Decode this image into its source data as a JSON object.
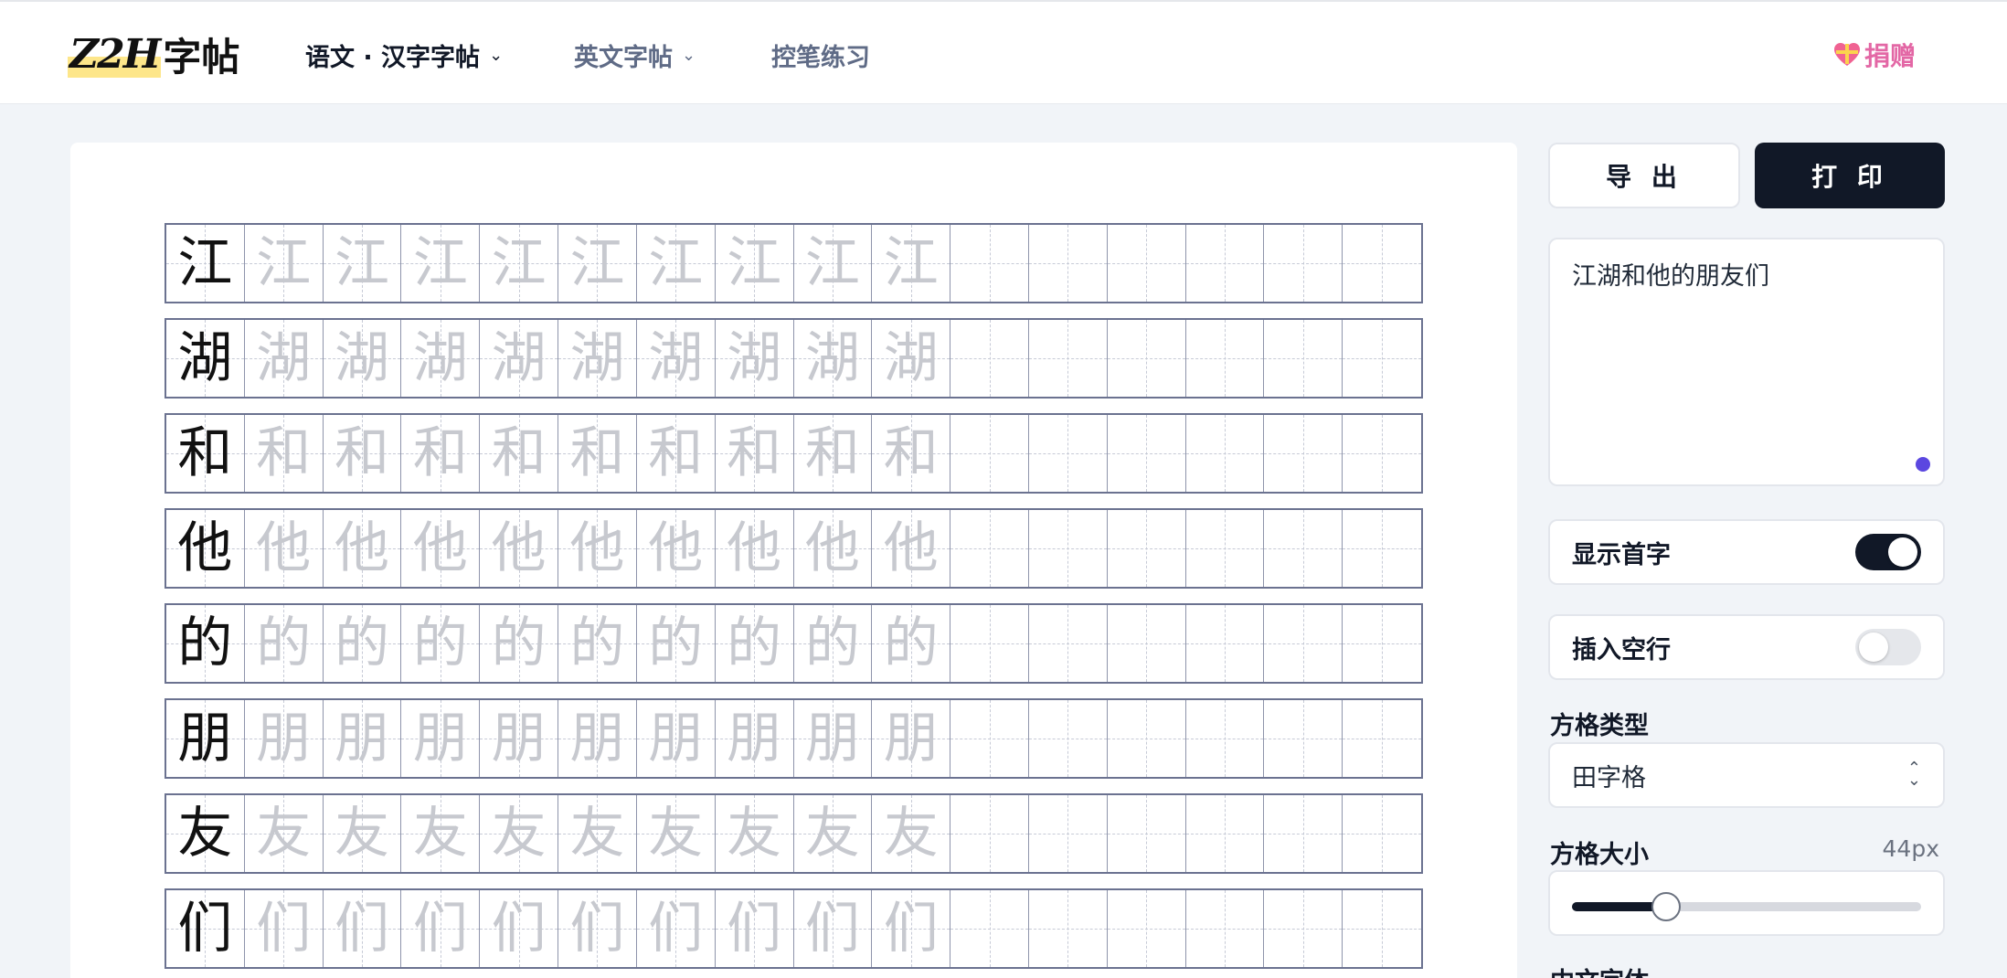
{
  "header": {
    "logo": {
      "latin": "Z2H",
      "hanzi": "字帖"
    },
    "nav": [
      {
        "label": "语文 · 汉字字帖",
        "chevron": "chevron-down-icon"
      },
      {
        "label": "英文字帖",
        "chevron": "chevron-down-icon"
      },
      {
        "label": "控笔练习"
      }
    ],
    "donate_label": "捐赠",
    "donate_icon": "gift-heart-icon"
  },
  "worksheet": {
    "characters": [
      "江",
      "湖",
      "和",
      "他",
      "的",
      "朋",
      "友",
      "们"
    ],
    "cells_per_row": 16,
    "trace_count": 9,
    "grid_type": "田字格"
  },
  "panel": {
    "export_label": "导 出",
    "print_label": "打 印",
    "text_input": "江湖和他的朋友们",
    "show_first_char": {
      "label": "显示首字",
      "on": true
    },
    "insert_blank_row": {
      "label": "插入空行",
      "on": false
    },
    "grid_type": {
      "label": "方格类型",
      "value": "田字格"
    },
    "grid_size": {
      "label": "方格大小",
      "value": "44px",
      "fraction": 0.27
    },
    "font_label": "中文字体"
  },
  "colors": {
    "accent_dark": "#111827",
    "donate": "#e367a5",
    "trace": "#c7c9cf",
    "resize_dot": "#5b47e0"
  }
}
